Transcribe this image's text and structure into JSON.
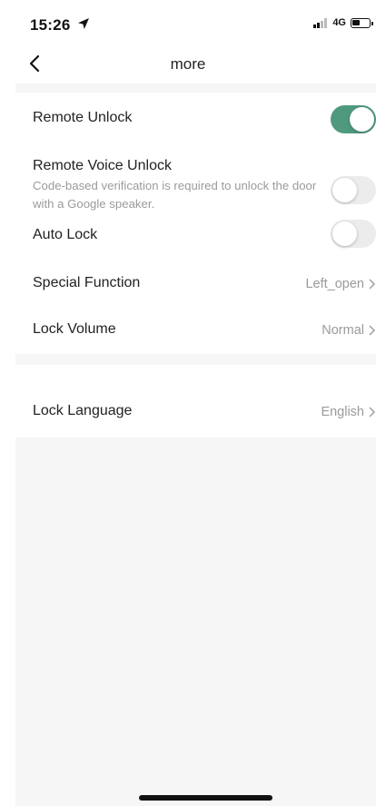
{
  "status_bar": {
    "time": "15:26",
    "network": "4G",
    "battery_level_percent": 45,
    "icons": [
      "location-arrow-icon",
      "cellular-signal-icon",
      "battery-icon"
    ]
  },
  "nav": {
    "title": "more",
    "back_icon": "chevron-left-icon"
  },
  "settings": {
    "remote_unlock": {
      "label": "Remote Unlock",
      "enabled": true
    },
    "remote_voice_unlock": {
      "label": "Remote Voice Unlock",
      "description": "Code-based verification is required to unlock the door with a Google speaker.",
      "enabled": false
    },
    "auto_lock": {
      "label": "Auto Lock",
      "enabled": false
    },
    "special_function": {
      "label": "Special Function",
      "value": "Left_open"
    },
    "lock_volume": {
      "label": "Lock Volume",
      "value": "Normal"
    },
    "lock_language": {
      "label": "Lock Language",
      "value": "English"
    }
  },
  "colors": {
    "toggle_on": "#4f9a7e",
    "toggle_off": "#ececec",
    "section_background": "#f6f6f6",
    "secondary_text": "#9b9b9b"
  }
}
